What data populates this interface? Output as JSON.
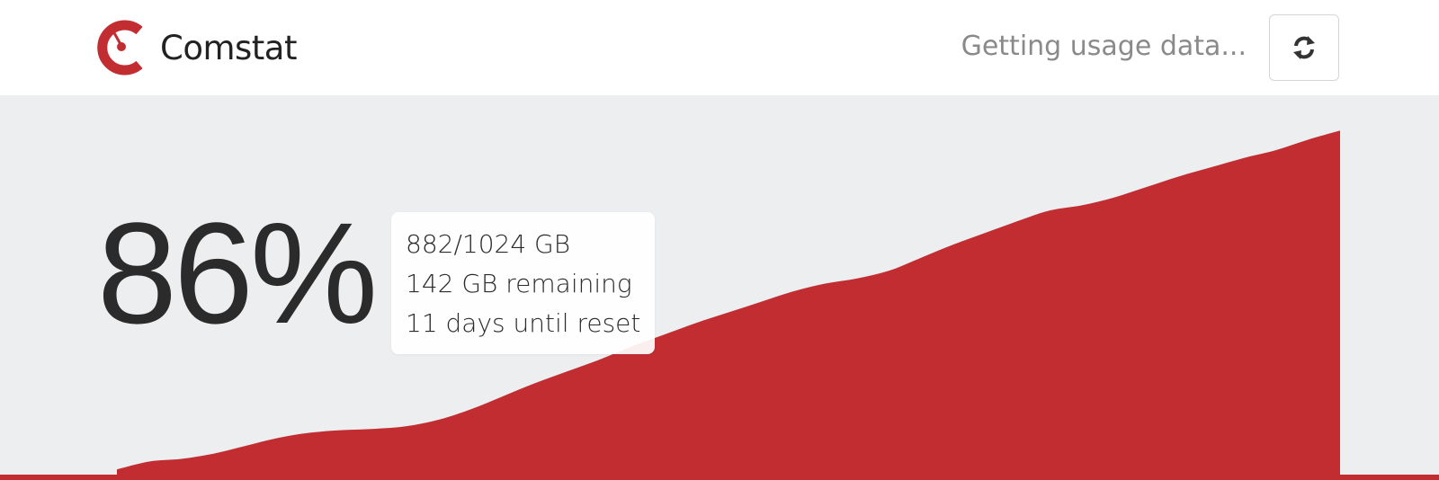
{
  "header": {
    "app_name": "Comstat",
    "status": "Getting usage data...",
    "logo_icon": "comstat-gauge-icon",
    "refresh_icon": "refresh-icon"
  },
  "usage": {
    "percent_label": "86%",
    "percent": 86,
    "used_total": "882/1024 GB",
    "remaining": "142 GB remaining",
    "reset": "11 days until reset"
  },
  "colors": {
    "accent": "#c22d32",
    "background": "#edeef0",
    "header_bg": "#ffffff",
    "text": "#2b2b2b",
    "muted_text": "#8a8a8a"
  },
  "chart_data": {
    "type": "area",
    "series": [
      {
        "values": [
          2,
          5,
          6,
          8,
          11,
          14,
          16,
          17,
          17.5,
          18.5,
          21,
          25,
          30,
          35,
          39.5,
          44,
          49,
          53.5,
          58,
          62,
          66,
          70,
          73,
          75,
          78,
          83,
          88,
          92.5,
          97,
          101,
          103,
          106,
          110,
          114,
          117.5,
          121,
          124,
          128,
          131.5
        ]
      }
    ],
    "xlabel": "",
    "ylabel": "",
    "ylim": [
      0,
      145
    ],
    "grid": false,
    "legend": "none"
  }
}
